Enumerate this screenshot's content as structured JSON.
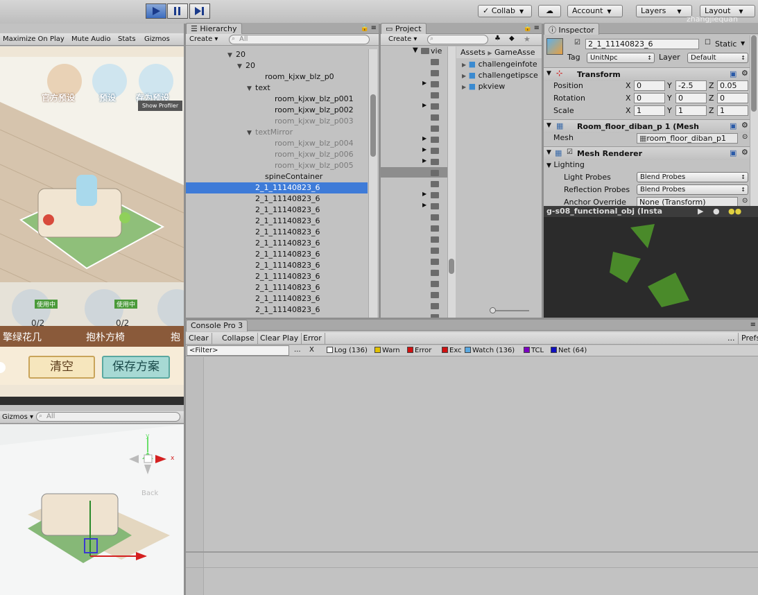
{
  "toolbar": {
    "collab": "Collab",
    "account": "Account",
    "layers": "Layers",
    "layout": "Layout",
    "user": "zhangjiequan"
  },
  "game_view": {
    "buttons": [
      "Maximize On Play",
      "Mute Audio",
      "Stats",
      "Gizmos"
    ],
    "hud_labels": [
      "官方预设",
      "预设",
      "存为预设"
    ],
    "show_profiler": "Show Profiler",
    "items": [
      {
        "name": "擎绿花几",
        "count": "0/2",
        "tag": "使用中"
      },
      {
        "name": "抱朴方椅",
        "count": "0/2",
        "tag": "使用中"
      },
      {
        "name": "抱",
        "count": "",
        "tag": ""
      }
    ],
    "clear_button": "清空",
    "save_button": "保存方案"
  },
  "scene_view": {
    "gizmos": "Gizmos",
    "search_placeholder": "All",
    "axis_y": "y",
    "axis_x": "x",
    "back_label": "Back"
  },
  "hierarchy": {
    "tab": "Hierarchy",
    "create": "Create",
    "search_placeholder": "All",
    "rows": [
      {
        "label": "20",
        "indent": 4,
        "arrow": "▼",
        "dim": false,
        "sel": false
      },
      {
        "label": "20",
        "indent": 5,
        "arrow": "▼",
        "dim": false,
        "sel": false
      },
      {
        "label": "room_kjxw_blz_p0",
        "indent": 7,
        "arrow": "",
        "dim": false,
        "sel": false
      },
      {
        "label": "text",
        "indent": 6,
        "arrow": "▼",
        "dim": false,
        "sel": false
      },
      {
        "label": "room_kjxw_blz_p001",
        "indent": 8,
        "arrow": "",
        "dim": false,
        "sel": false
      },
      {
        "label": "room_kjxw_blz_p002",
        "indent": 8,
        "arrow": "",
        "dim": false,
        "sel": false
      },
      {
        "label": "room_kjxw_blz_p003",
        "indent": 8,
        "arrow": "",
        "dim": true,
        "sel": false
      },
      {
        "label": "textMirror",
        "indent": 6,
        "arrow": "▼",
        "dim": true,
        "sel": false
      },
      {
        "label": "room_kjxw_blz_p004",
        "indent": 8,
        "arrow": "",
        "dim": true,
        "sel": false
      },
      {
        "label": "room_kjxw_blz_p006",
        "indent": 8,
        "arrow": "",
        "dim": true,
        "sel": false
      },
      {
        "label": "room_kjxw_blz_p005",
        "indent": 8,
        "arrow": "",
        "dim": true,
        "sel": false
      },
      {
        "label": "spineContainer",
        "indent": 7,
        "arrow": "",
        "dim": false,
        "sel": false
      },
      {
        "label": "2_1_11140823_6",
        "indent": 6,
        "arrow": "",
        "dim": false,
        "sel": true
      },
      {
        "label": "2_1_11140823_6",
        "indent": 6,
        "arrow": "",
        "dim": false,
        "sel": false
      },
      {
        "label": "2_1_11140823_6",
        "indent": 6,
        "arrow": "",
        "dim": false,
        "sel": false
      },
      {
        "label": "2_1_11140823_6",
        "indent": 6,
        "arrow": "",
        "dim": false,
        "sel": false
      },
      {
        "label": "2_1_11140823_6",
        "indent": 6,
        "arrow": "",
        "dim": false,
        "sel": false
      },
      {
        "label": "2_1_11140823_6",
        "indent": 6,
        "arrow": "",
        "dim": false,
        "sel": false
      },
      {
        "label": "2_1_11140823_6",
        "indent": 6,
        "arrow": "",
        "dim": false,
        "sel": false
      },
      {
        "label": "2_1_11140823_6",
        "indent": 6,
        "arrow": "",
        "dim": false,
        "sel": false
      },
      {
        "label": "2_1_11140823_6",
        "indent": 6,
        "arrow": "",
        "dim": false,
        "sel": false
      },
      {
        "label": "2_1_11140823_6",
        "indent": 6,
        "arrow": "",
        "dim": false,
        "sel": false
      },
      {
        "label": "2_1_11140823_6",
        "indent": 6,
        "arrow": "",
        "dim": false,
        "sel": false
      },
      {
        "label": "2_1_11140823_6",
        "indent": 6,
        "arrow": "",
        "dim": false,
        "sel": false
      }
    ]
  },
  "project": {
    "tab": "Project",
    "create": "Create",
    "tree_label": "vie",
    "breadcrumb": [
      "Assets",
      "GameAsse"
    ],
    "assets": [
      "challengeinfote",
      "challengetipsce",
      "pkview"
    ]
  },
  "inspector": {
    "tab": "Inspector",
    "object_name": "2_1_11140823_6",
    "static_label": "Static",
    "tag_label": "Tag",
    "tag_value": "UnitNpc",
    "layer_label": "Layer",
    "layer_value": "Default",
    "transform": {
      "title": "Transform",
      "position_label": "Position",
      "rotation_label": "Rotation",
      "scale_label": "Scale",
      "position": [
        "0",
        "-2.5",
        "0.05"
      ],
      "rotation": [
        "0",
        "0",
        "0"
      ],
      "scale": [
        "1",
        "1",
        "1"
      ]
    },
    "mesh_filter": {
      "title": "Room_floor_diban_p 1 (Mesh",
      "mesh_label": "Mesh",
      "mesh_value": "room_floor_diban_p1"
    },
    "mesh_renderer": {
      "title": "Mesh Renderer",
      "lighting": "Lighting",
      "light_probes_label": "Light Probes",
      "light_probes_value": "Blend Probes",
      "reflection_probes_label": "Reflection Probes",
      "reflection_probes_value": "Blend Probes",
      "anchor_override_label": "Anchor Override",
      "anchor_override_value": "None (Transform)"
    },
    "preview_title": "g-s08_functional_obj (Insta"
  },
  "console": {
    "tab": "Console Pro 3",
    "buttons": [
      "Clear",
      "Collapse",
      "Clear Play",
      "Error"
    ],
    "more": "...",
    "prefs": "Prefs",
    "filter_placeholder": "<Filter>",
    "filter_more": "...",
    "filter_clear": "X",
    "categories": [
      {
        "label": "Log (136)",
        "color": "#ffffff"
      },
      {
        "label": "Warn",
        "color": "#e0c000"
      },
      {
        "label": "Error",
        "color": "#d01010"
      },
      {
        "label": "Exc",
        "color": "#d01010"
      },
      {
        "label": "Watch (136)",
        "color": "#5aa8e0"
      },
      {
        "label": "TCL",
        "color": "#7a00c0"
      },
      {
        "label": "Net (64)",
        "color": "#1010c0"
      }
    ]
  }
}
